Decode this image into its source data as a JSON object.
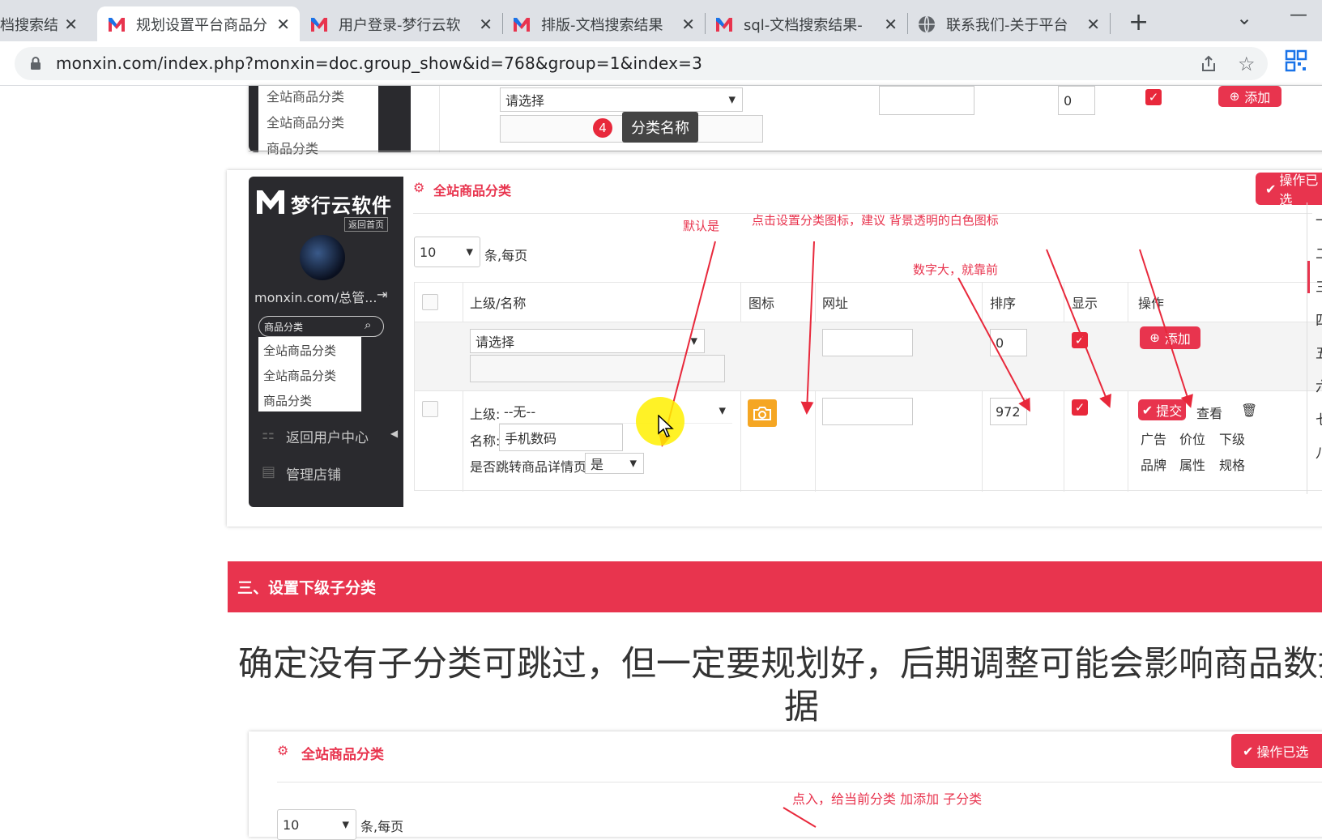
{
  "tabs": [
    {
      "title": "档搜索结",
      "active": false
    },
    {
      "title": "规划设置平台商品分",
      "active": true
    },
    {
      "title": "用户登录-梦行云软",
      "active": false
    },
    {
      "title": "排版-文档搜索结果",
      "active": false
    },
    {
      "title": "sql-文档搜索结果-",
      "active": false
    },
    {
      "title": "联系我们-关于平台",
      "active": false
    }
  ],
  "browser": {
    "url": "monxin.com/index.php?monxin=doc.group_show&id=768&group=1&index=3",
    "new_tab": "+",
    "chevron": "⌄",
    "minimize": "—"
  },
  "top_fragment": {
    "sidebar_items": [
      "全站商品分类",
      "全站商品分类",
      "商品分类"
    ],
    "select_placeholder": "请选择",
    "order_value": "0",
    "add_label": "添加",
    "badge_number": "4",
    "tooltip": "分类名称"
  },
  "admin": {
    "logo_text": "梦行云软件",
    "back_home": "返回首页",
    "username": "monxin.com/总管...",
    "search_placeholder": "商品分类",
    "dropdown_items": [
      "全站商品分类",
      "全站商品分类",
      "商品分类"
    ],
    "nav_user_center": "返回用户中心",
    "nav_manage_shop": "管理店铺",
    "section_title": "全站商品分类",
    "op_done_button": "操作已选",
    "per_page_value": "10",
    "per_page_label": "条,每页",
    "columns": [
      "上级/名称",
      "图标",
      "网址",
      "排序",
      "显示",
      "操作"
    ],
    "new_row": {
      "parent_select": "请选择",
      "order": "0",
      "add_label": "添加"
    },
    "row": {
      "parent_label": "上级:",
      "parent_value": "--无--",
      "name_label": "名称:",
      "name_value": "手机数码",
      "jump_label": "是否跳转商品详情页:",
      "jump_value": "是",
      "order": "972",
      "submit": "提交",
      "view": "查看",
      "links": [
        "广告",
        "价位",
        "下级",
        "品牌",
        "属性",
        "规格"
      ]
    },
    "right_numbers": [
      "一",
      "二",
      "三",
      "四",
      "五",
      "六",
      "七",
      "八"
    ]
  },
  "annotations": {
    "default_yes": "默认是",
    "icon_hint": "点击设置分类图标，建议 背景透明的白色图标",
    "order_hint": "数字大，就靠前"
  },
  "section3": {
    "heading": "三、设置下级子分类",
    "body": "确定没有子分类可跳过，但一定要规划好，后期调整可能会影响商品数据",
    "body_line2": "据",
    "sub_title": "全站商品分类",
    "op_done_button": "操作已选",
    "annotation": "点入，给当前分类 加添加 子分类",
    "per_page_value": "10",
    "per_page_label": "条,每页"
  },
  "colors": {
    "accent": "#e8344e",
    "dark_sidebar": "#2a2a2e",
    "tab_bar": "#dee1e6",
    "icon_orange": "#f5a623"
  }
}
